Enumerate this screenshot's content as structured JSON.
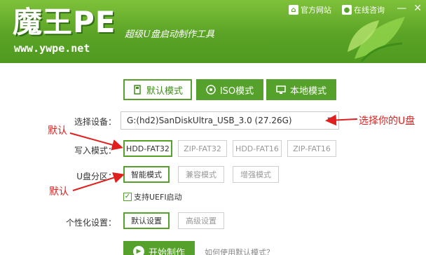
{
  "header": {
    "logo_text": "魔王PE",
    "site": "www.ywpe.net",
    "slogan": "超级U盘启动制作工具",
    "links": [
      {
        "icon": "home-icon",
        "label": "官方网站"
      },
      {
        "icon": "chat-icon",
        "label": "在线咨询"
      }
    ],
    "window_buttons": {
      "minimize": "—",
      "close": "✕"
    }
  },
  "tabs": [
    {
      "icon": "usb-icon",
      "label": "默认模式",
      "state": "active"
    },
    {
      "icon": "disc-icon",
      "label": "ISO模式",
      "state": "normal"
    },
    {
      "icon": "monitor-icon",
      "label": "本地模式",
      "state": "normal"
    }
  ],
  "form": {
    "device_label": "选择设备：",
    "device_value": "G:(hd2)SanDiskUltra_USB_3.0 (27.26G)",
    "write_mode_label": "写入模式：",
    "write_modes": [
      "HDD-FAT32",
      "ZIP-FAT32",
      "HDD-FAT16",
      "ZIP-FAT16"
    ],
    "write_mode_selected": "HDD-FAT32",
    "partition_label": "U盘分区：",
    "partitions": [
      "智能模式",
      "兼容模式",
      "增强模式"
    ],
    "partition_selected": "智能模式",
    "uefi_label": "支持UEFI启动",
    "uefi_checked": true,
    "personalize_label": "个性化设置：",
    "personalize_options": [
      "默认设置",
      "高级设置"
    ],
    "personalize_selected": "默认设置",
    "start_button": "开始制作",
    "howto_link": "如何使用默认模式？"
  },
  "annotations": {
    "default_1": "默认",
    "default_2": "默认",
    "select_hint": "选择你的U盘"
  },
  "colors": {
    "brand_green": "#55a12b",
    "header_top": "#7fc13a",
    "annotation_red": "#e0201e"
  }
}
